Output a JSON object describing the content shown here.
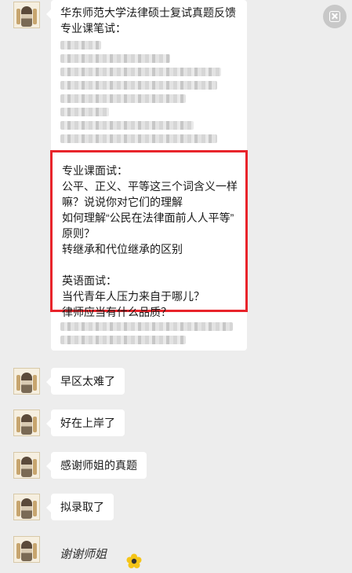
{
  "message1": {
    "header_lines": [
      "华东师范大学法律硕士复试真题反馈",
      "专业课笔试："
    ],
    "highlight": {
      "oral_title": "专业课面试：",
      "oral_lines": [
        "公平、正义、平等这三个词含义一样",
        "嘛？说说你对它们的理解",
        "如何理解“公民在法律面前人人平等”",
        "原则？",
        "转继承和代位继承的区别"
      ],
      "english_title": "英语面试：",
      "english_lines": [
        "当代青年人压力来自于哪儿？",
        "律师应当有什么品质？"
      ]
    }
  },
  "messages": [
    {
      "text": "早区太难了"
    },
    {
      "text": "好在上岸了"
    },
    {
      "text": "感谢师姐的真题"
    },
    {
      "text": "拟录取了"
    }
  ],
  "sticker": {
    "text": "谢谢师姐"
  },
  "colors": {
    "background": "#ededed",
    "bubble": "#ffffff",
    "highlight_border": "#e8242b"
  },
  "icons": {
    "close": "close-icon",
    "sticker": "flower-icon"
  }
}
